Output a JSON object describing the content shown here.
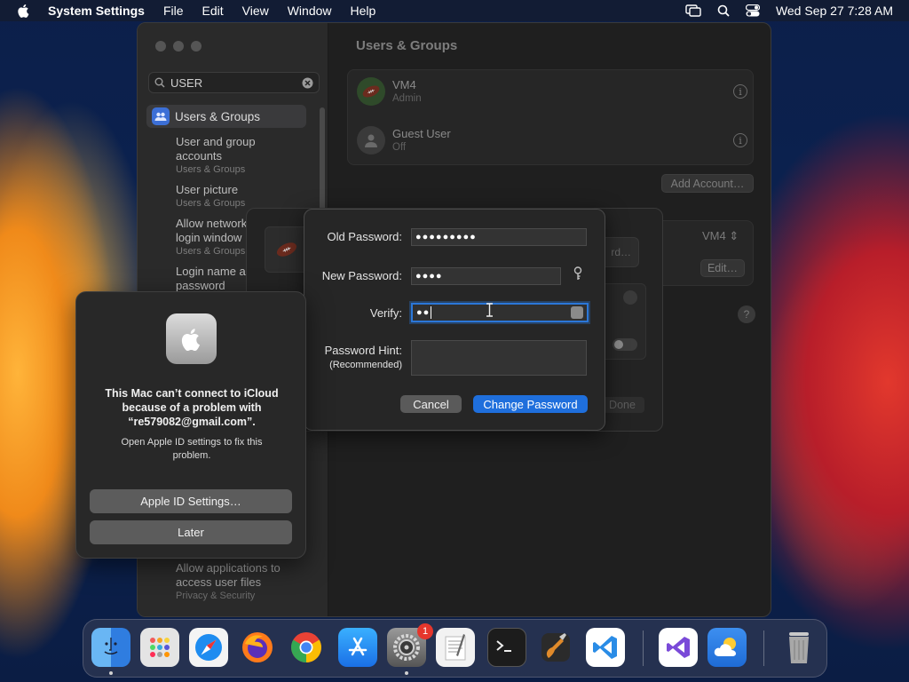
{
  "menubar": {
    "app_name": "System Settings",
    "items": [
      "File",
      "Edit",
      "View",
      "Window",
      "Help"
    ],
    "clock": "Wed Sep 27  7:28 AM"
  },
  "sidebar": {
    "search_value": "USER",
    "selected": "Users & Groups",
    "results": [
      {
        "title": "User and group accounts",
        "sub": "Users & Groups"
      },
      {
        "title": "User picture",
        "sub": "Users & Groups"
      },
      {
        "title": "Allow network login window",
        "sub": "Users & Groups"
      },
      {
        "title": "Login name and password",
        "sub": ""
      }
    ],
    "bottom_result": {
      "title": "Allow applications to access user files",
      "sub": "Privacy & Security"
    }
  },
  "content": {
    "title": "Users & Groups",
    "users": [
      {
        "name": "VM4",
        "role": "Admin"
      },
      {
        "name": "Guest User",
        "role": "Off"
      }
    ],
    "add_account": "Add Account…",
    "vm4_select": "VM4",
    "edit": "Edit…",
    "sheet_button": "rd…",
    "done": "Done",
    "help": "?"
  },
  "password_dialog": {
    "old_label": "Old Password:",
    "old_value": "●●●●●●●●●",
    "new_label": "New Password:",
    "new_value": "●●●●",
    "verify_label": "Verify:",
    "verify_value": "●●",
    "hint_label": "Password Hint:",
    "hint_note": "(Recommended)",
    "cancel": "Cancel",
    "change": "Change Password"
  },
  "alert": {
    "message": "This Mac can’t connect to iCloud because of a problem with “re579082@gmail.com”.",
    "detail": "Open Apple ID settings to fix this problem.",
    "primary": "Apple ID Settings…",
    "secondary": "Later"
  },
  "dock": {
    "settings_badge": "1",
    "apps": [
      "finder",
      "launchpad",
      "safari",
      "firefox",
      "chrome",
      "app-store",
      "system-settings",
      "textedit",
      "terminal",
      "garageband",
      "vscode",
      "visual-studio",
      "weather",
      "trash"
    ]
  }
}
